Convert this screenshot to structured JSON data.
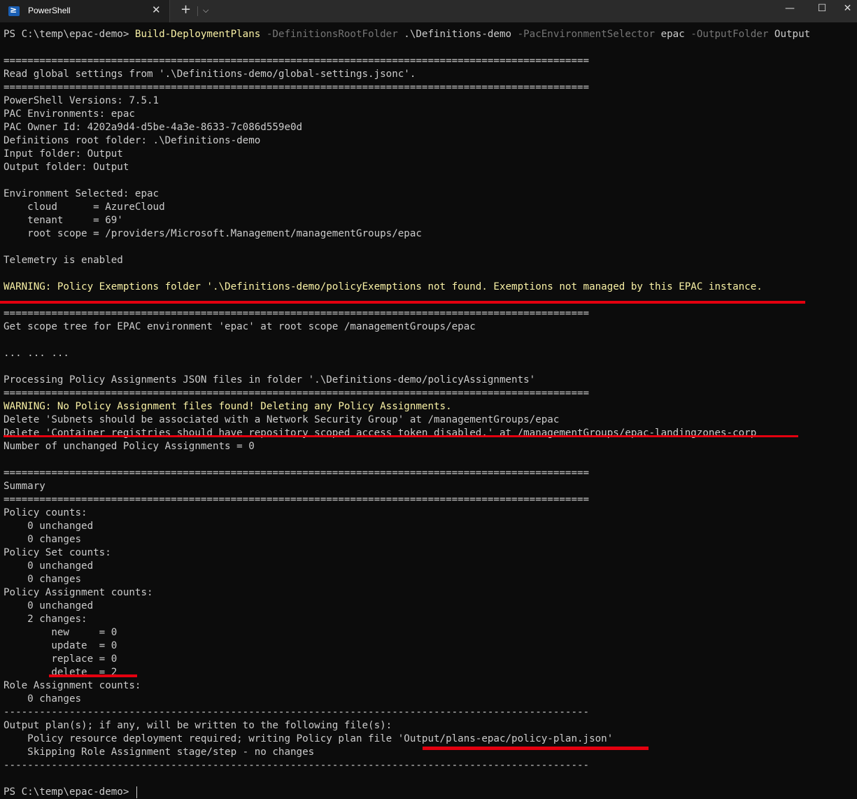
{
  "window": {
    "tab_title": "PowerShell",
    "tab_close": "✕",
    "new_tab": "+",
    "dropdown": "⌵",
    "minimize": "—",
    "maximize": "☐",
    "close": "✕"
  },
  "colors": {
    "background": "#0c0c0c",
    "text": "#cccccc",
    "warning": "#f9f1a5",
    "parameter": "#767676",
    "highlight_underline": "#e3000f"
  },
  "command": {
    "prompt": "PS C:\\temp\\epac-demo> ",
    "cmdlet": "Build-DeploymentPlans",
    "p1": " -DefinitionsRootFolder",
    "v1": " .\\Definitions-demo",
    "p2": " -PacEnvironmentSelector",
    "v2": " epac",
    "p3": " -OutputFolder",
    "v3": " Output"
  },
  "output": [
    {
      "text": "",
      "type": "normal"
    },
    {
      "text": "==================================================================================================",
      "type": "normal"
    },
    {
      "text": "Read global settings from '.\\Definitions-demo/global-settings.jsonc'.",
      "type": "normal"
    },
    {
      "text": "==================================================================================================",
      "type": "normal"
    },
    {
      "text": "PowerShell Versions: 7.5.1",
      "type": "normal"
    },
    {
      "text": "PAC Environments: epac",
      "type": "normal"
    },
    {
      "text": "PAC Owner Id: 4202a9d4-d5be-4a3e-8633-7c086d559e0d",
      "type": "normal"
    },
    {
      "text": "Definitions root folder: .\\Definitions-demo",
      "type": "normal"
    },
    {
      "text": "Input folder: Output",
      "type": "normal"
    },
    {
      "text": "Output folder: Output",
      "type": "normal"
    },
    {
      "text": "",
      "type": "normal"
    },
    {
      "text": "Environment Selected: epac",
      "type": "normal"
    },
    {
      "text": "    cloud      = AzureCloud",
      "type": "normal"
    },
    {
      "text": "    tenant     = 69'",
      "type": "normal"
    },
    {
      "text": "    root scope = /providers/Microsoft.Management/managementGroups/epac",
      "type": "normal"
    },
    {
      "text": "",
      "type": "normal"
    },
    {
      "text": "Telemetry is enabled",
      "type": "normal"
    },
    {
      "text": "",
      "type": "normal"
    },
    {
      "text": "WARNING: Policy Exemptions folder '.\\Definitions-demo/policyExemptions not found. Exemptions not managed by this EPAC instance.",
      "type": "warn"
    },
    {
      "text": "",
      "type": "normal"
    },
    {
      "text": "==================================================================================================",
      "type": "normal"
    },
    {
      "text": "Get scope tree for EPAC environment 'epac' at root scope /managementGroups/epac",
      "type": "normal"
    },
    {
      "text": "",
      "type": "normal"
    },
    {
      "text": "... ... ...",
      "type": "normal"
    },
    {
      "text": "",
      "type": "normal"
    },
    {
      "text": "Processing Policy Assignments JSON files in folder '.\\Definitions-demo/policyAssignments'",
      "type": "normal"
    },
    {
      "text": "==================================================================================================",
      "type": "normal"
    },
    {
      "text": "WARNING: No Policy Assignment files found! Deleting any Policy Assignments.",
      "type": "warn"
    },
    {
      "text": "Delete 'Subnets should be associated with a Network Security Group' at /managementGroups/epac",
      "type": "normal"
    },
    {
      "text": "Delete 'Container registries should have repository scoped access token disabled.' at /managementGroups/epac-landingzones-corp",
      "type": "normal"
    },
    {
      "text": "Number of unchanged Policy Assignments = 0",
      "type": "normal"
    },
    {
      "text": "",
      "type": "normal"
    },
    {
      "text": "==================================================================================================",
      "type": "normal"
    },
    {
      "text": "Summary",
      "type": "normal"
    },
    {
      "text": "==================================================================================================",
      "type": "normal"
    },
    {
      "text": "Policy counts:",
      "type": "normal"
    },
    {
      "text": "    0 unchanged",
      "type": "normal"
    },
    {
      "text": "    0 changes",
      "type": "normal"
    },
    {
      "text": "Policy Set counts:",
      "type": "normal"
    },
    {
      "text": "    0 unchanged",
      "type": "normal"
    },
    {
      "text": "    0 changes",
      "type": "normal"
    },
    {
      "text": "Policy Assignment counts:",
      "type": "normal"
    },
    {
      "text": "    0 unchanged",
      "type": "normal"
    },
    {
      "text": "    2 changes:",
      "type": "normal"
    },
    {
      "text": "        new     = 0",
      "type": "normal"
    },
    {
      "text": "        update  = 0",
      "type": "normal"
    },
    {
      "text": "        replace = 0",
      "type": "normal"
    },
    {
      "text": "        delete  = 2",
      "type": "normal"
    },
    {
      "text": "Role Assignment counts:",
      "type": "normal"
    },
    {
      "text": "    0 changes",
      "type": "normal"
    },
    {
      "text": "--------------------------------------------------------------------------------------------------",
      "type": "normal"
    },
    {
      "text": "Output plan(s); if any, will be written to the following file(s):",
      "type": "normal"
    },
    {
      "text": "    Policy resource deployment required; writing Policy plan file 'Output/plans-epac/policy-plan.json'",
      "type": "normal"
    },
    {
      "text": "    Skipping Role Assignment stage/step - no changes",
      "type": "normal"
    },
    {
      "text": "--------------------------------------------------------------------------------------------------",
      "type": "normal"
    },
    {
      "text": "",
      "type": "normal"
    }
  ],
  "final_prompt": "PS C:\\temp\\epac-demo> "
}
